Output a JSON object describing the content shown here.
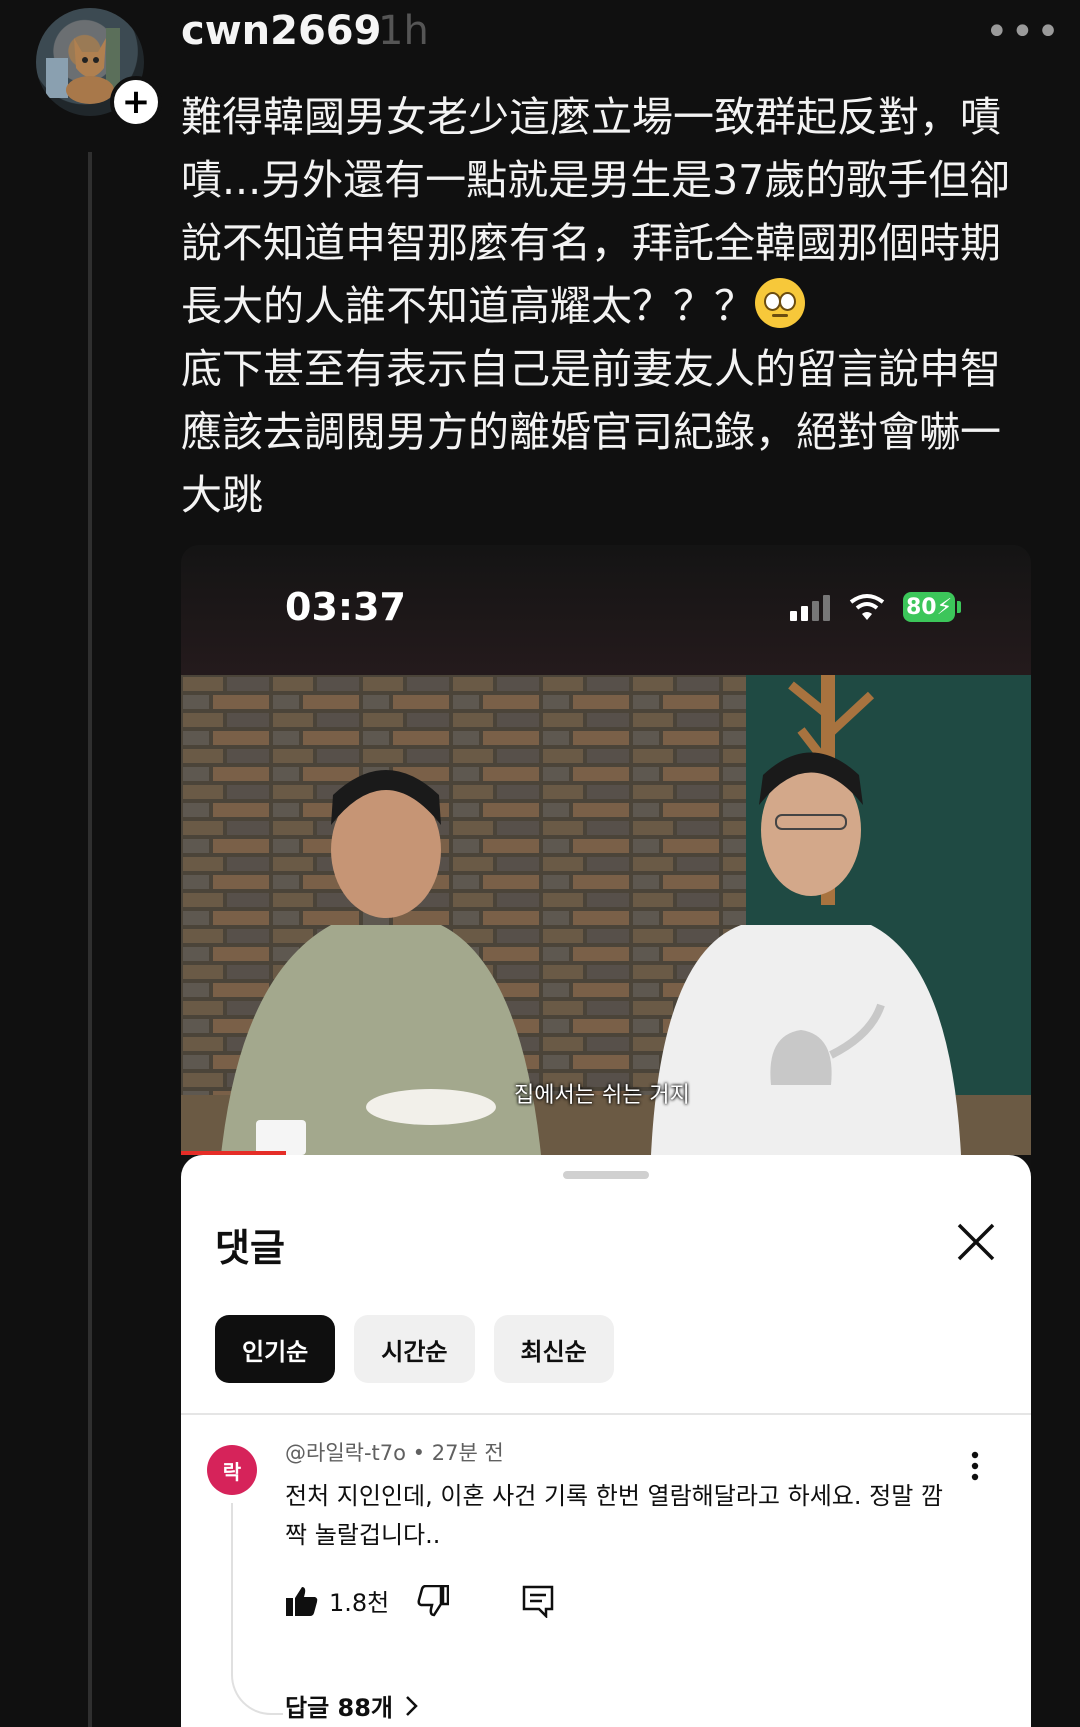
{
  "post": {
    "username": "cwn2669",
    "time": "1h",
    "more_icon": "more-horizontal-icon",
    "follow_icon": "plus-icon",
    "text_lines": [
      "難得韓國男女老少這麼立場一致群起反對，嘖",
      "嘖...另外還有一點就是男生是37歲的歌手但卻",
      "說不知道申智那麼有名，拜託全韓國那個時期",
      "長大的人誰不知道高耀太？？？",
      "底下甚至有表示自己是前妻友人的留言說申智",
      "應該去調閱男方的離婚官司紀錄，絕對會嚇一",
      "大跳"
    ],
    "emoji": "face-with-rolling-eyes"
  },
  "screenshot": {
    "status_time": "03:37",
    "battery": "80",
    "video_subtitle": "집에서는 쉬는 거지",
    "comments": {
      "title": "댓글",
      "sort_chips": [
        "인기순",
        "시간순",
        "최신순"
      ],
      "active_chip": "인기순",
      "comment": {
        "avatar_text": "락",
        "avatar_color": "#d6235a",
        "meta": "@라일락-t7o • 27분 전",
        "text": "전처 지인인데, 이혼 사건 기록 한번 열람해달라고 하세요. 정말 깜짝 놀랄겁니다..",
        "likes": "1.8천",
        "replies_label": "답글 88개"
      }
    }
  }
}
